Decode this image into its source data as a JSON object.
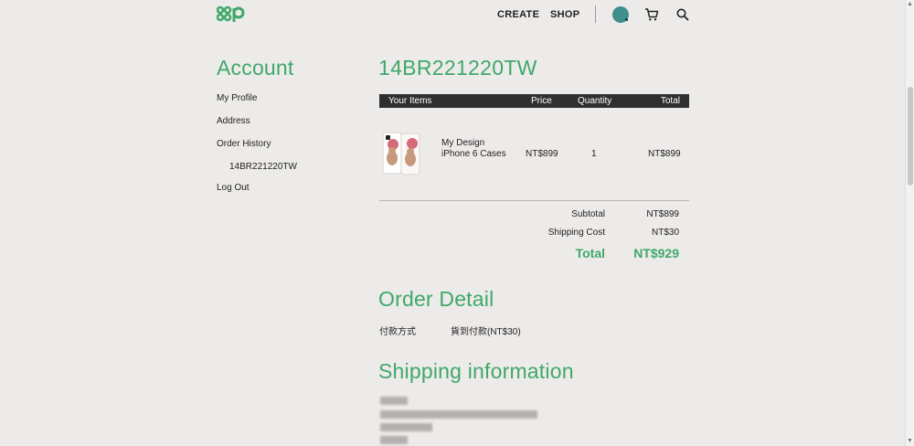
{
  "header": {
    "nav": [
      "CREATE",
      "SHOP"
    ]
  },
  "sidebar": {
    "title": "Account",
    "items": [
      {
        "label": "My Profile"
      },
      {
        "label": "Address"
      },
      {
        "label": "Order History"
      },
      {
        "label": "14BR221220TW"
      },
      {
        "label": "Log Out"
      }
    ]
  },
  "order": {
    "id": "14BR221220TW",
    "columns": [
      "Your Items",
      "Price",
      "Quantity",
      "Total"
    ],
    "item": {
      "name_line1": "My Design",
      "name_line2": "iPhone 6 Cases",
      "price": "NT$899",
      "quantity": "1",
      "total": "NT$899"
    },
    "summary": {
      "subtotal_label": "Subtotal",
      "subtotal": "NT$899",
      "shipping_label": "Shipping Cost",
      "shipping": "NT$30",
      "total_label": "Total",
      "total": "NT$929"
    }
  },
  "order_detail": {
    "title": "Order Detail",
    "payment_label": "付款方式",
    "payment_value": "貨到付款(NT$30)"
  },
  "shipping": {
    "title": "Shipping information"
  },
  "icons": {
    "logo": "88p-logo",
    "cart": "cart-icon",
    "search": "search-icon"
  },
  "colors": {
    "accent": "#3fa86a",
    "avatar": "#3f8f8e",
    "table_header": "#2f2f2f"
  }
}
